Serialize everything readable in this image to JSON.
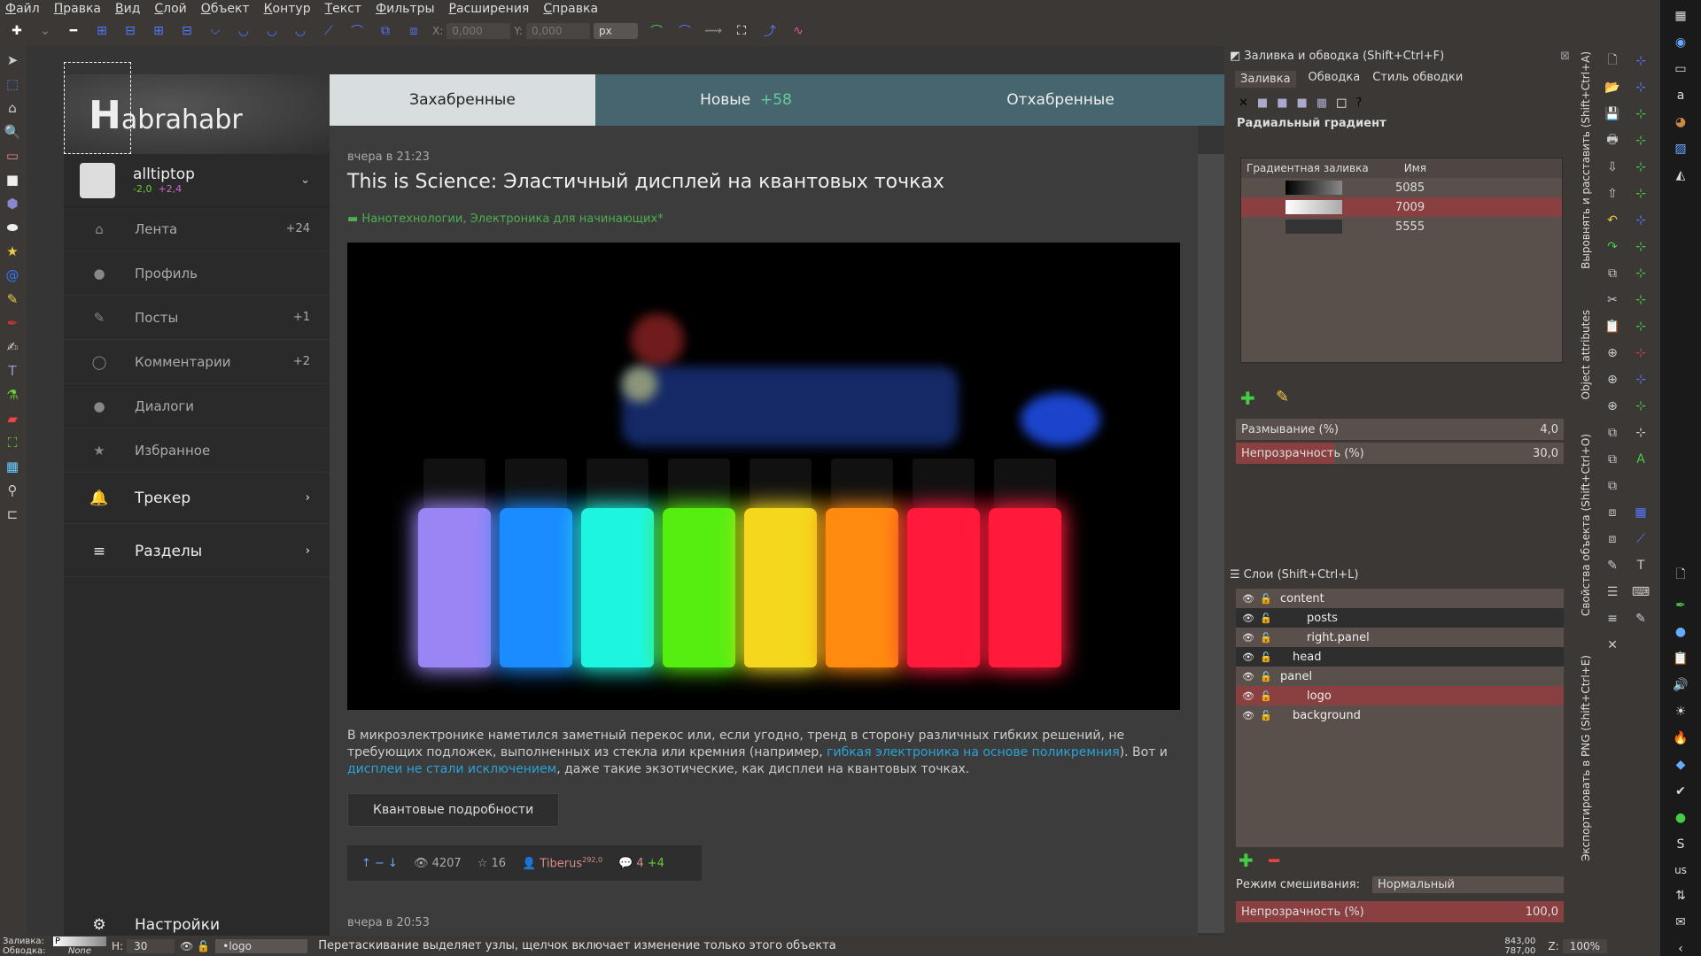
{
  "menu": [
    "Файл",
    "Правка",
    "Вид",
    "Слой",
    "Объект",
    "Контур",
    "Текст",
    "Фильтры",
    "Расширения",
    "Справка"
  ],
  "toolbar": {
    "x_label": "X:",
    "x_value": "0,000",
    "y_label": "Y:",
    "y_value": "0,000",
    "unit": "px"
  },
  "habr": {
    "logo": "abrahabr",
    "logo_h": "H",
    "user": {
      "name": "alltiptop",
      "karma": "-2,0",
      "rating": "+2,4"
    },
    "nav": [
      {
        "icon": "home-icon",
        "glyph": "⌂",
        "label": "Лента",
        "count": "+24"
      },
      {
        "icon": "user-icon",
        "glyph": "●",
        "label": "Профиль",
        "count": ""
      },
      {
        "icon": "pencil-icon",
        "glyph": "✎",
        "label": "Посты",
        "count": "+1"
      },
      {
        "icon": "comment-icon",
        "glyph": "◯",
        "label": "Комментарии",
        "count": "+2"
      },
      {
        "icon": "dialogs-icon",
        "glyph": "●",
        "label": "Диалоги",
        "count": ""
      },
      {
        "icon": "star-icon",
        "glyph": "★",
        "label": "Избранное",
        "count": ""
      }
    ],
    "tracker": "Трекер",
    "sections": "Разделы",
    "settings": "Настройки",
    "tabs": [
      {
        "label": "Захабренные"
      },
      {
        "label": "Новые",
        "badge": "+58"
      },
      {
        "label": "Отхабренные"
      }
    ],
    "post": {
      "time": "вчера в 21:23",
      "title": "This is Science: Эластичный дисплей на квантовых точках",
      "hubs": "Нанотехнологии, Электроника для начинающих*",
      "text1": "В микроэлектронике наметился заметный перекос или, если угодно, тренд в сторону различных гибких решений, не требующих подложек, выполненных из стекла или кремния (например, ",
      "link1": "гибкая электроника на основе поликремния",
      "text2": "). Вот и ",
      "link2": "дисплеи не стали исключением",
      "text3": ", даже такие экзотические, как дисплеи на квантовых точках.",
      "readmore": "Квантовые подробности",
      "views": "4207",
      "favs": "16",
      "author": "Tiberus",
      "author_karma": "292,0",
      "comments": "4",
      "comments_new": "+4"
    },
    "post2_time": "вчера в 20:53"
  },
  "fill_stroke": {
    "title": "Заливка и обводка (Shift+Ctrl+F)",
    "tabs": [
      "Заливка",
      "Обводка",
      "Стиль обводки"
    ],
    "gradient_type": "Радиальный градиент",
    "col_grad": "Градиентная заливка",
    "col_name": "Имя",
    "gradients": [
      {
        "name": "5085"
      },
      {
        "name": "7009",
        "selected": true
      },
      {
        "name": "5555"
      }
    ],
    "blur_label": "Размывание (%)",
    "blur_value": "4,0",
    "opacity_label": "Непрозрачность (%)",
    "opacity_value": "30,0"
  },
  "layers": {
    "title": "Слои (Shift+Ctrl+L)",
    "items": [
      {
        "name": "content",
        "level": 0,
        "expanded": true
      },
      {
        "name": "posts",
        "level": 1
      },
      {
        "name": "right.panel",
        "level": 1
      },
      {
        "name": "head",
        "level": 0
      },
      {
        "name": "panel",
        "level": 0,
        "expanded": true
      },
      {
        "name": "logo",
        "level": 1,
        "selected": true
      },
      {
        "name": "background",
        "level": 0
      }
    ],
    "blend_label": "Режим смешивания:",
    "blend_value": "Нормальный",
    "opacity_label": "Непрозрачность (%)",
    "opacity_value": "100,0"
  },
  "vertical_tabs": [
    "Выровнять и расставить (Shift+Ctrl+A)",
    "Object attributes",
    "Свойства объекта (Shift+Ctrl+O)",
    "Экспортировать в PNG (Shift+Ctrl+E)"
  ],
  "status": {
    "fill_label": "Заливка:",
    "stroke_label": "Обводка:",
    "stroke_value": "None",
    "fill_value": "P",
    "h_label": "H:",
    "h_value": "30",
    "layer": "•logo",
    "message": "Перетаскивание выделяет узлы, щелчок включает изменение только этого объекта",
    "x": "843,00",
    "y": "787,00",
    "zoom_label": "Z:",
    "zoom": "100%"
  },
  "sys": {
    "lang": "us"
  }
}
